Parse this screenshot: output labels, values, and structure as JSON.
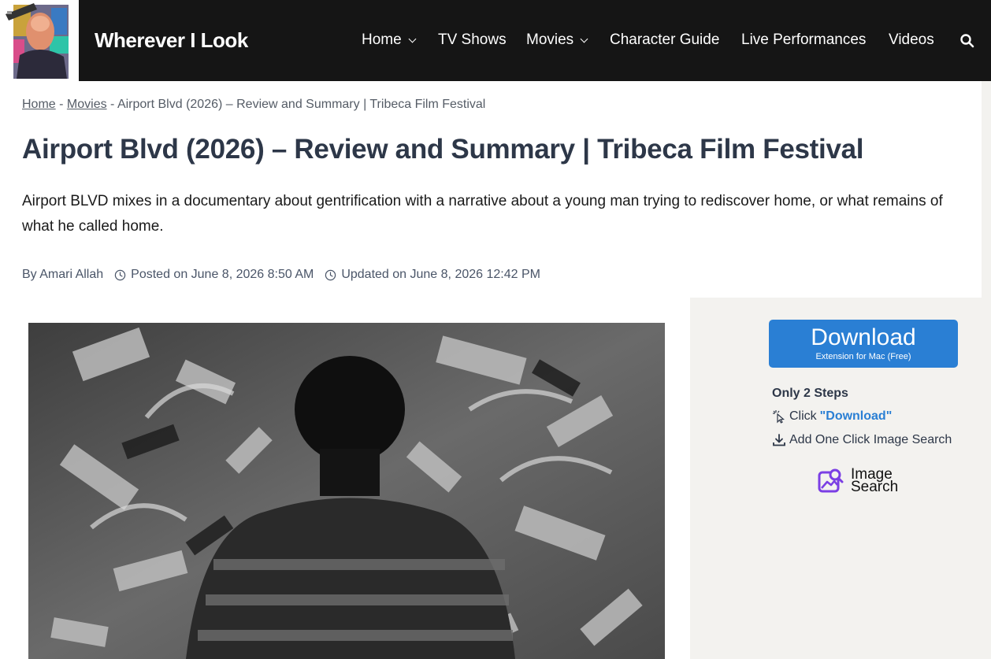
{
  "header": {
    "site_title": "Wherever I Look",
    "nav": [
      {
        "label": "Home",
        "dropdown": true
      },
      {
        "label": "TV Shows",
        "dropdown": false
      },
      {
        "label": "Movies",
        "dropdown": true
      },
      {
        "label": "Character Guide",
        "dropdown": false
      },
      {
        "label": "Live Performances",
        "dropdown": false
      },
      {
        "label": "Videos",
        "dropdown": false
      }
    ],
    "search_icon": "search-icon"
  },
  "breadcrumb": {
    "home": "Home",
    "sep1": " - ",
    "movies": "Movies",
    "sep2": " - ",
    "current": "Airport Blvd (2026) – Review and Summary | Tribeca Film Festival"
  },
  "article": {
    "title": "Airport Blvd (2026) – Review and Summary | Tribeca Film Festival",
    "excerpt": "Airport BLVD mixes in a documentary about gentrification with a narrative about a young man trying to rediscover home, or what remains of what he called home.",
    "author": "By Amari Allah",
    "posted": "Posted on June 8, 2026 8:50 AM",
    "updated": "Updated on June 8, 2026 12:42 PM"
  },
  "sidebar": {
    "download_label": "Download",
    "download_sub": "Extension for Mac (Free)",
    "steps_title": "Only 2 Steps",
    "step1_prefix": "Click",
    "step1_highlight": "\"Download\"",
    "step2": "Add One Click Image Search",
    "brand_line1": "Image",
    "brand_line2": "Search"
  },
  "colors": {
    "header_bg": "#151515",
    "accent_blue": "#2a7fd4",
    "brand_purple": "#7b3fe4",
    "sidebar_bg": "#f3f2ef"
  }
}
